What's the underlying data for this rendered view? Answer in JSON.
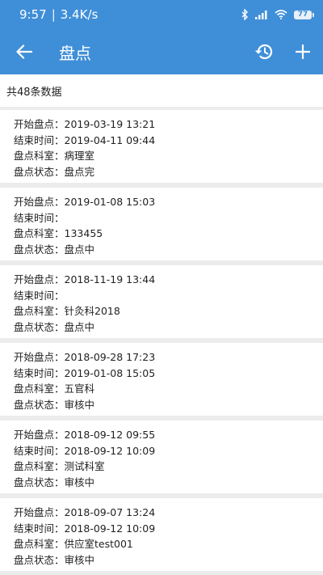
{
  "status_bar": {
    "time": "9:57",
    "separator": "|",
    "speed": "3.4K/s",
    "battery": "77",
    "icons": [
      "bluetooth-icon",
      "signal-icon",
      "wifi-icon",
      "battery-icon"
    ]
  },
  "app_bar": {
    "title": "盘点",
    "back_icon": "arrow-left-icon",
    "history_icon": "history-icon",
    "add_icon": "plus-icon"
  },
  "summary": {
    "text": "共48条数据"
  },
  "labels": {
    "start": "开始盘点：",
    "end": "结束时间：",
    "dept": "盘点科室：",
    "status": "盘点状态："
  },
  "records": [
    {
      "start": "2019-03-19 13:21",
      "end": "2019-04-11 09:44",
      "dept": "病理室",
      "status": "盘点完"
    },
    {
      "start": "2019-01-08 15:03",
      "end": "",
      "dept": "133455",
      "status": "盘点中"
    },
    {
      "start": "2018-11-19 13:44",
      "end": "",
      "dept": "针灸科2018",
      "status": "盘点中"
    },
    {
      "start": "2018-09-28 17:23",
      "end": "2019-01-08 15:05",
      "dept": "五官科",
      "status": "审核中"
    },
    {
      "start": "2018-09-12 09:55",
      "end": "2018-09-12 10:09",
      "dept": "测试科室",
      "status": "审核中"
    },
    {
      "start": "2018-09-07 13:24",
      "end": "2018-09-12 10:09",
      "dept": "供应室test001",
      "status": "审核中"
    }
  ],
  "colors": {
    "primary": "#3f8fd8",
    "background": "#ececec",
    "card": "#ffffff"
  }
}
